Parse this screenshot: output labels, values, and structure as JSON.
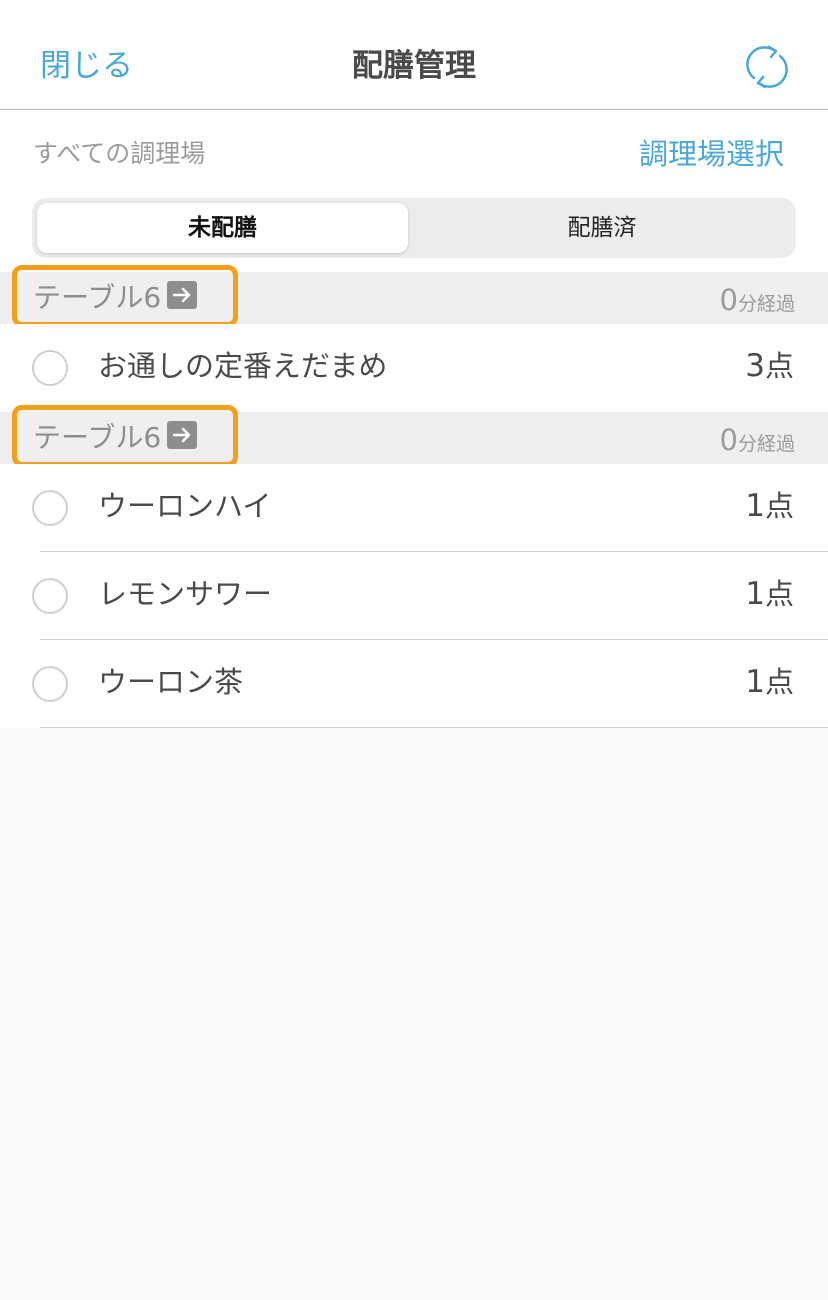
{
  "header": {
    "close_label": "閉じる",
    "title": "配膳管理",
    "refresh_icon": "refresh-icon"
  },
  "filter": {
    "kitchen_label": "すべての調理場",
    "select_label": "調理場選択"
  },
  "tabs": [
    {
      "label": "未配膳",
      "active": true
    },
    {
      "label": "配膳済",
      "active": false
    }
  ],
  "groups": [
    {
      "table_label": "テーブル6",
      "elapsed_value": "0",
      "elapsed_unit": "分経過",
      "items": [
        {
          "name": "お通しの定番えだまめ",
          "qty": "3",
          "unit": "点"
        }
      ]
    },
    {
      "table_label": "テーブル6",
      "elapsed_value": "0",
      "elapsed_unit": "分経過",
      "items": [
        {
          "name": "ウーロンハイ",
          "qty": "1",
          "unit": "点"
        },
        {
          "name": "レモンサワー",
          "qty": "1",
          "unit": "点"
        },
        {
          "name": "ウーロン茶",
          "qty": "1",
          "unit": "点"
        }
      ]
    }
  ],
  "colors": {
    "accent": "#4aa8d8",
    "highlight": "#f5a01a",
    "group_bg": "#efefef"
  }
}
